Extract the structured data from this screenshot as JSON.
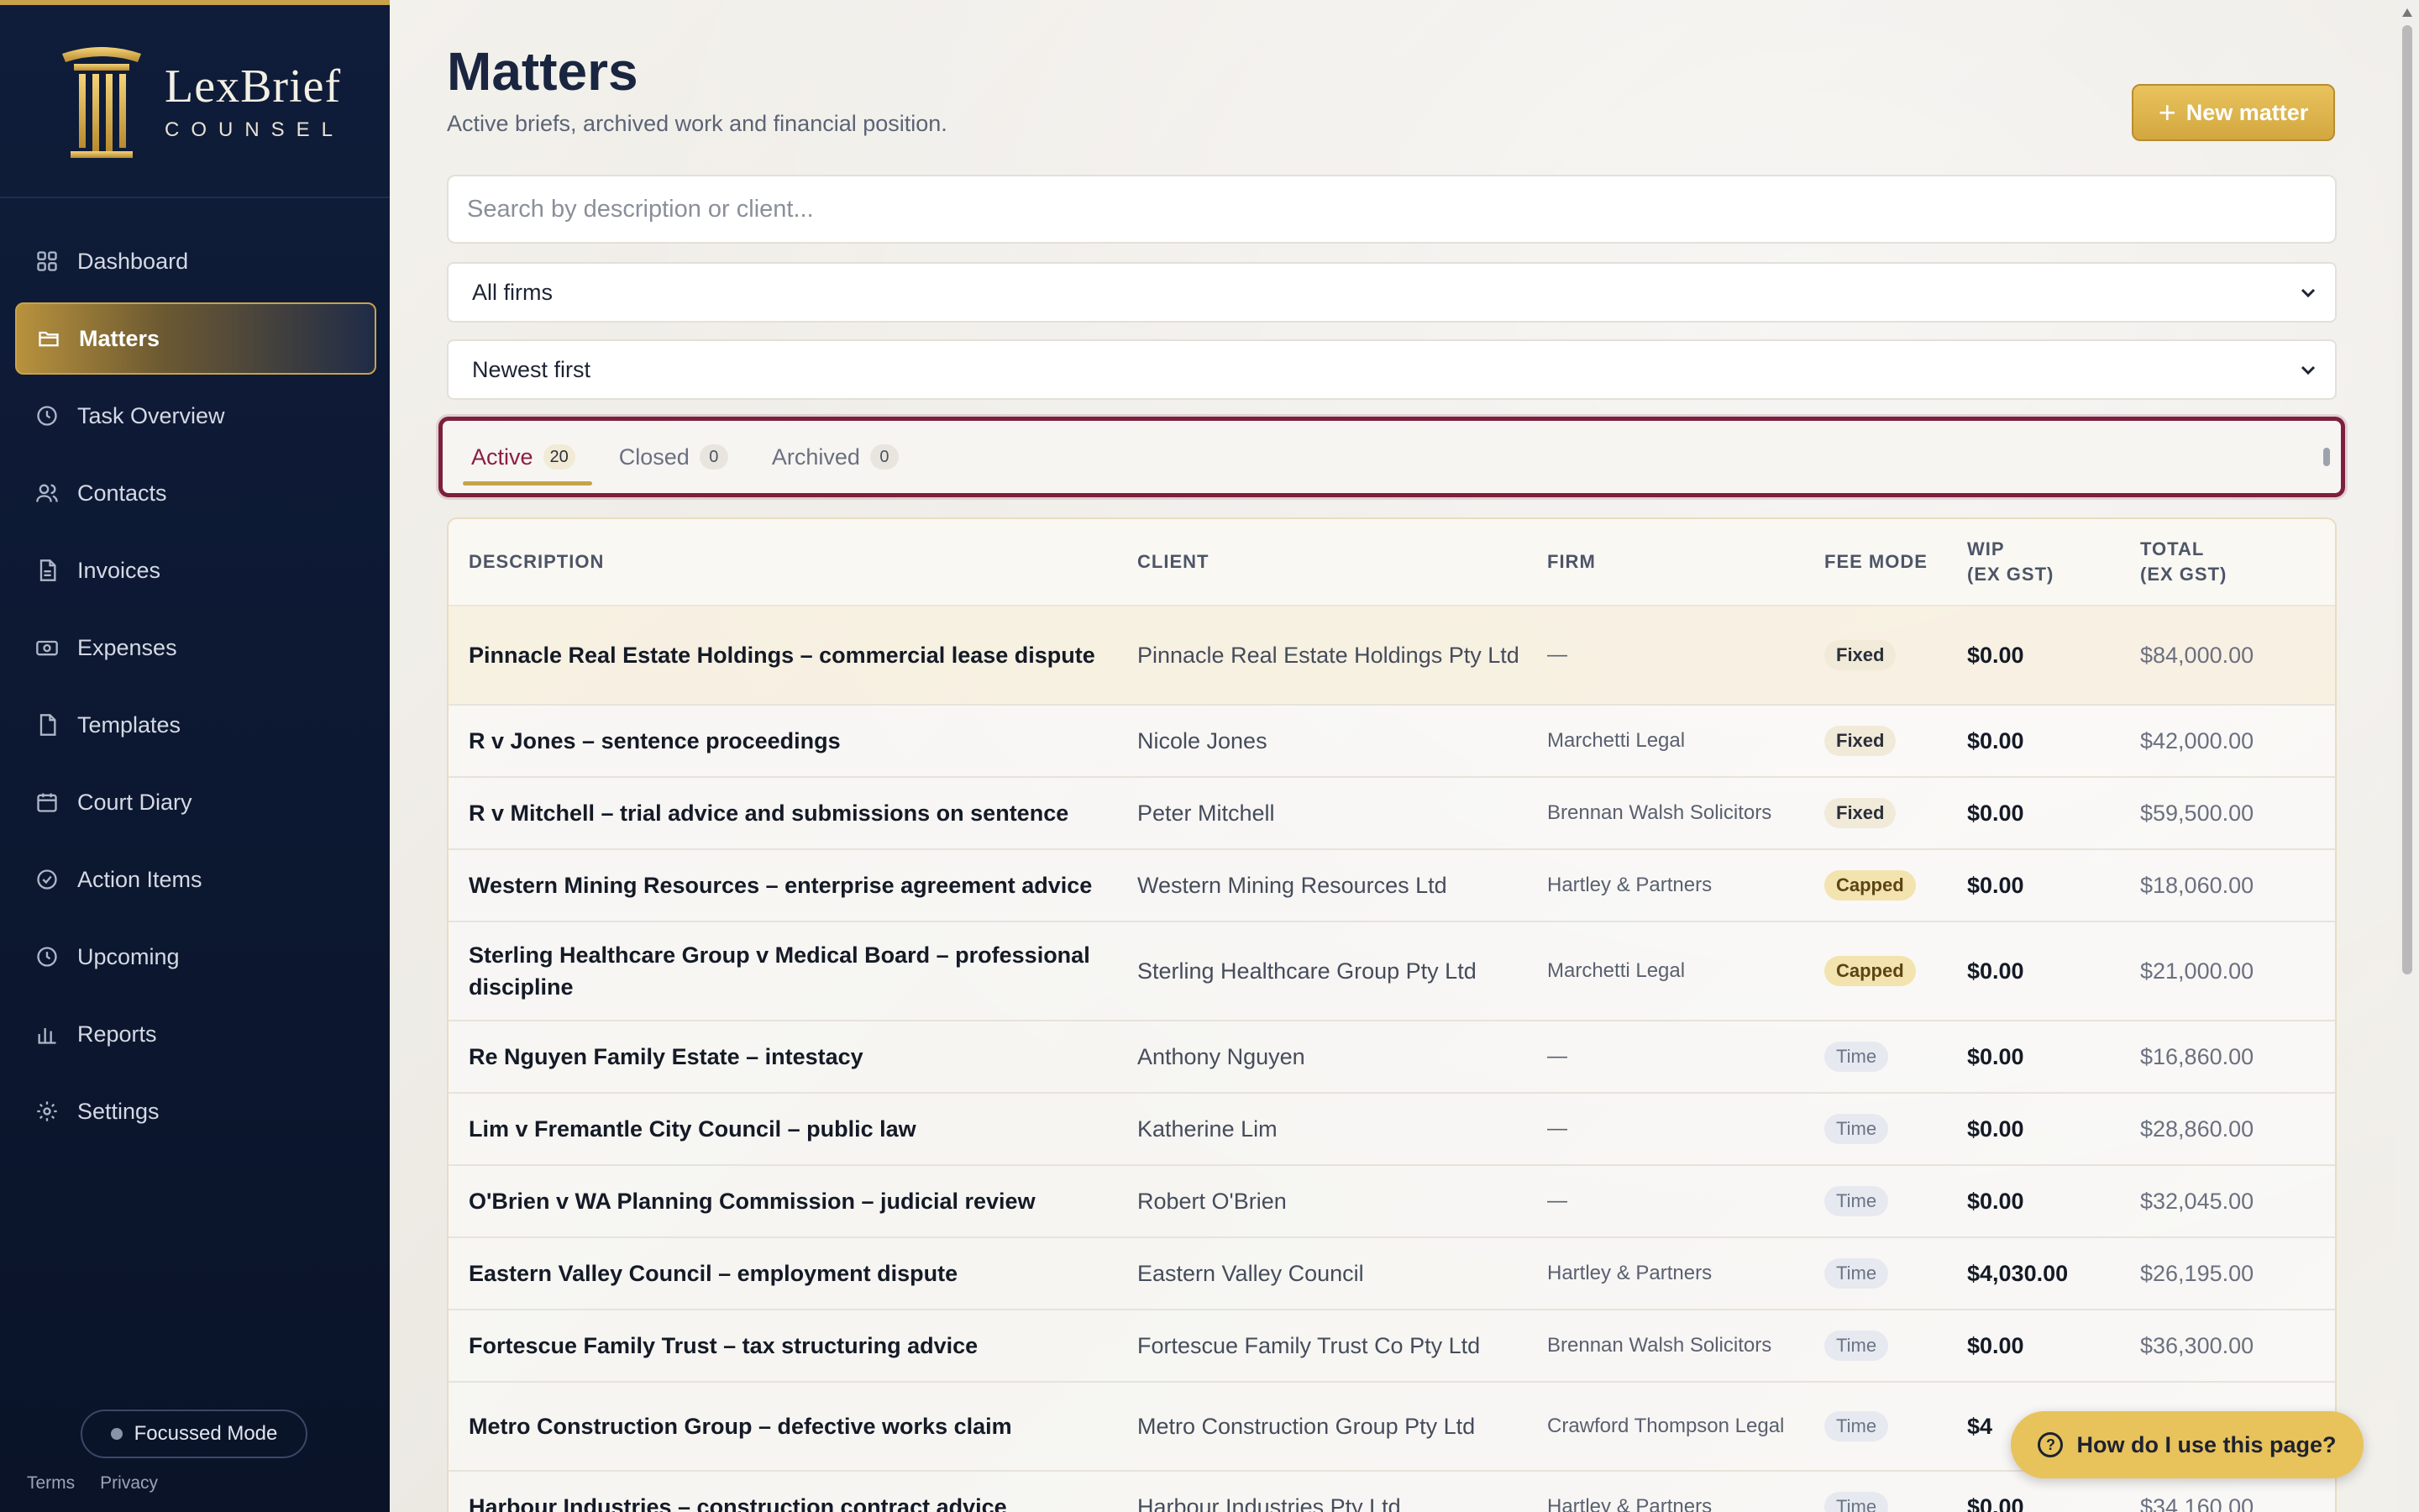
{
  "brand": {
    "name": "LexBrief",
    "sub": "COUNSEL"
  },
  "nav": [
    {
      "label": "Dashboard",
      "icon": "grid-icon",
      "active": false
    },
    {
      "label": "Matters",
      "icon": "folder-icon",
      "active": true
    },
    {
      "label": "Task Overview",
      "icon": "clock-icon",
      "active": false
    },
    {
      "label": "Contacts",
      "icon": "users-icon",
      "active": false
    },
    {
      "label": "Invoices",
      "icon": "document-icon",
      "active": false
    },
    {
      "label": "Expenses",
      "icon": "money-icon",
      "active": false
    },
    {
      "label": "Templates",
      "icon": "file-icon",
      "active": false
    },
    {
      "label": "Court Diary",
      "icon": "calendar-icon",
      "active": false
    },
    {
      "label": "Action Items",
      "icon": "check-circle-icon",
      "active": false
    },
    {
      "label": "Upcoming",
      "icon": "clock-icon",
      "active": false
    },
    {
      "label": "Reports",
      "icon": "bar-chart-icon",
      "active": false
    },
    {
      "label": "Settings",
      "icon": "gear-icon",
      "active": false
    }
  ],
  "focus_mode": "Focussed Mode",
  "footer": {
    "terms": "Terms",
    "privacy": "Privacy"
  },
  "page": {
    "title": "Matters",
    "subtitle": "Active briefs, archived work and financial position.",
    "new_button": "New matter"
  },
  "search": {
    "placeholder": "Search by description or client..."
  },
  "firm_filter": {
    "selected": "All firms"
  },
  "sort": {
    "selected": "Newest first"
  },
  "tabs": [
    {
      "label": "Active",
      "count": "20",
      "active": true
    },
    {
      "label": "Closed",
      "count": "0",
      "active": false
    },
    {
      "label": "Archived",
      "count": "0",
      "active": false
    }
  ],
  "table": {
    "headers": [
      "DESCRIPTION",
      "CLIENT",
      "FIRM",
      "FEE MODE",
      "WIP\n(EX GST)",
      "TOTAL\n(EX GST)"
    ],
    "rows": [
      {
        "desc": "Pinnacle Real Estate Holdings – commercial lease dispute",
        "client": "Pinnacle Real Estate Holdings Pty Ltd",
        "firm": "—",
        "fee": "Fixed",
        "wip": "$0.00",
        "total": "$84,000.00"
      },
      {
        "desc": "R v Jones – sentence proceedings",
        "client": "Nicole Jones",
        "firm": "Marchetti Legal",
        "fee": "Fixed",
        "wip": "$0.00",
        "total": "$42,000.00"
      },
      {
        "desc": "R v Mitchell – trial advice and submissions on sentence",
        "client": "Peter Mitchell",
        "firm": "Brennan Walsh Solicitors",
        "fee": "Fixed",
        "wip": "$0.00",
        "total": "$59,500.00"
      },
      {
        "desc": "Western Mining Resources – enterprise agreement advice",
        "client": "Western Mining Resources Ltd",
        "firm": "Hartley & Partners",
        "fee": "Capped",
        "wip": "$0.00",
        "total": "$18,060.00"
      },
      {
        "desc": "Sterling Healthcare Group v Medical Board – professional discipline",
        "client": "Sterling Healthcare Group Pty Ltd",
        "firm": "Marchetti Legal",
        "fee": "Capped",
        "wip": "$0.00",
        "total": "$21,000.00"
      },
      {
        "desc": "Re Nguyen Family Estate – intestacy",
        "client": "Anthony Nguyen",
        "firm": "—",
        "fee": "Time",
        "wip": "$0.00",
        "total": "$16,860.00"
      },
      {
        "desc": "Lim v Fremantle City Council – public law",
        "client": "Katherine Lim",
        "firm": "—",
        "fee": "Time",
        "wip": "$0.00",
        "total": "$28,860.00"
      },
      {
        "desc": "O'Brien v WA Planning Commission – judicial review",
        "client": "Robert O'Brien",
        "firm": "—",
        "fee": "Time",
        "wip": "$0.00",
        "total": "$32,045.00"
      },
      {
        "desc": "Eastern Valley Council – employment dispute",
        "client": "Eastern Valley Council",
        "firm": "Hartley & Partners",
        "fee": "Time",
        "wip": "$4,030.00",
        "total": "$26,195.00"
      },
      {
        "desc": "Fortescue Family Trust – tax structuring advice",
        "client": "Fortescue Family Trust Co Pty Ltd",
        "firm": "Brennan Walsh Solicitors",
        "fee": "Time",
        "wip": "$0.00",
        "total": "$36,300.00"
      },
      {
        "desc": "Metro Construction Group – defective works claim",
        "client": "Metro Construction Group Pty Ltd",
        "firm": "Crawford Thompson Legal",
        "fee": "Time",
        "wip": "$4",
        "total": ""
      },
      {
        "desc": "Harbour Industries – construction contract advice",
        "client": "Harbour Industries Pty Ltd",
        "firm": "Hartley & Partners",
        "fee": "Time",
        "wip": "$0.00",
        "total": "$34,160.00"
      }
    ]
  },
  "help_button": "How do I use this page?",
  "colors": {
    "accent_gold": "#c9a24a",
    "tab_outline": "#7d1f3e",
    "sidebar_bg": "#0f1d3a"
  }
}
